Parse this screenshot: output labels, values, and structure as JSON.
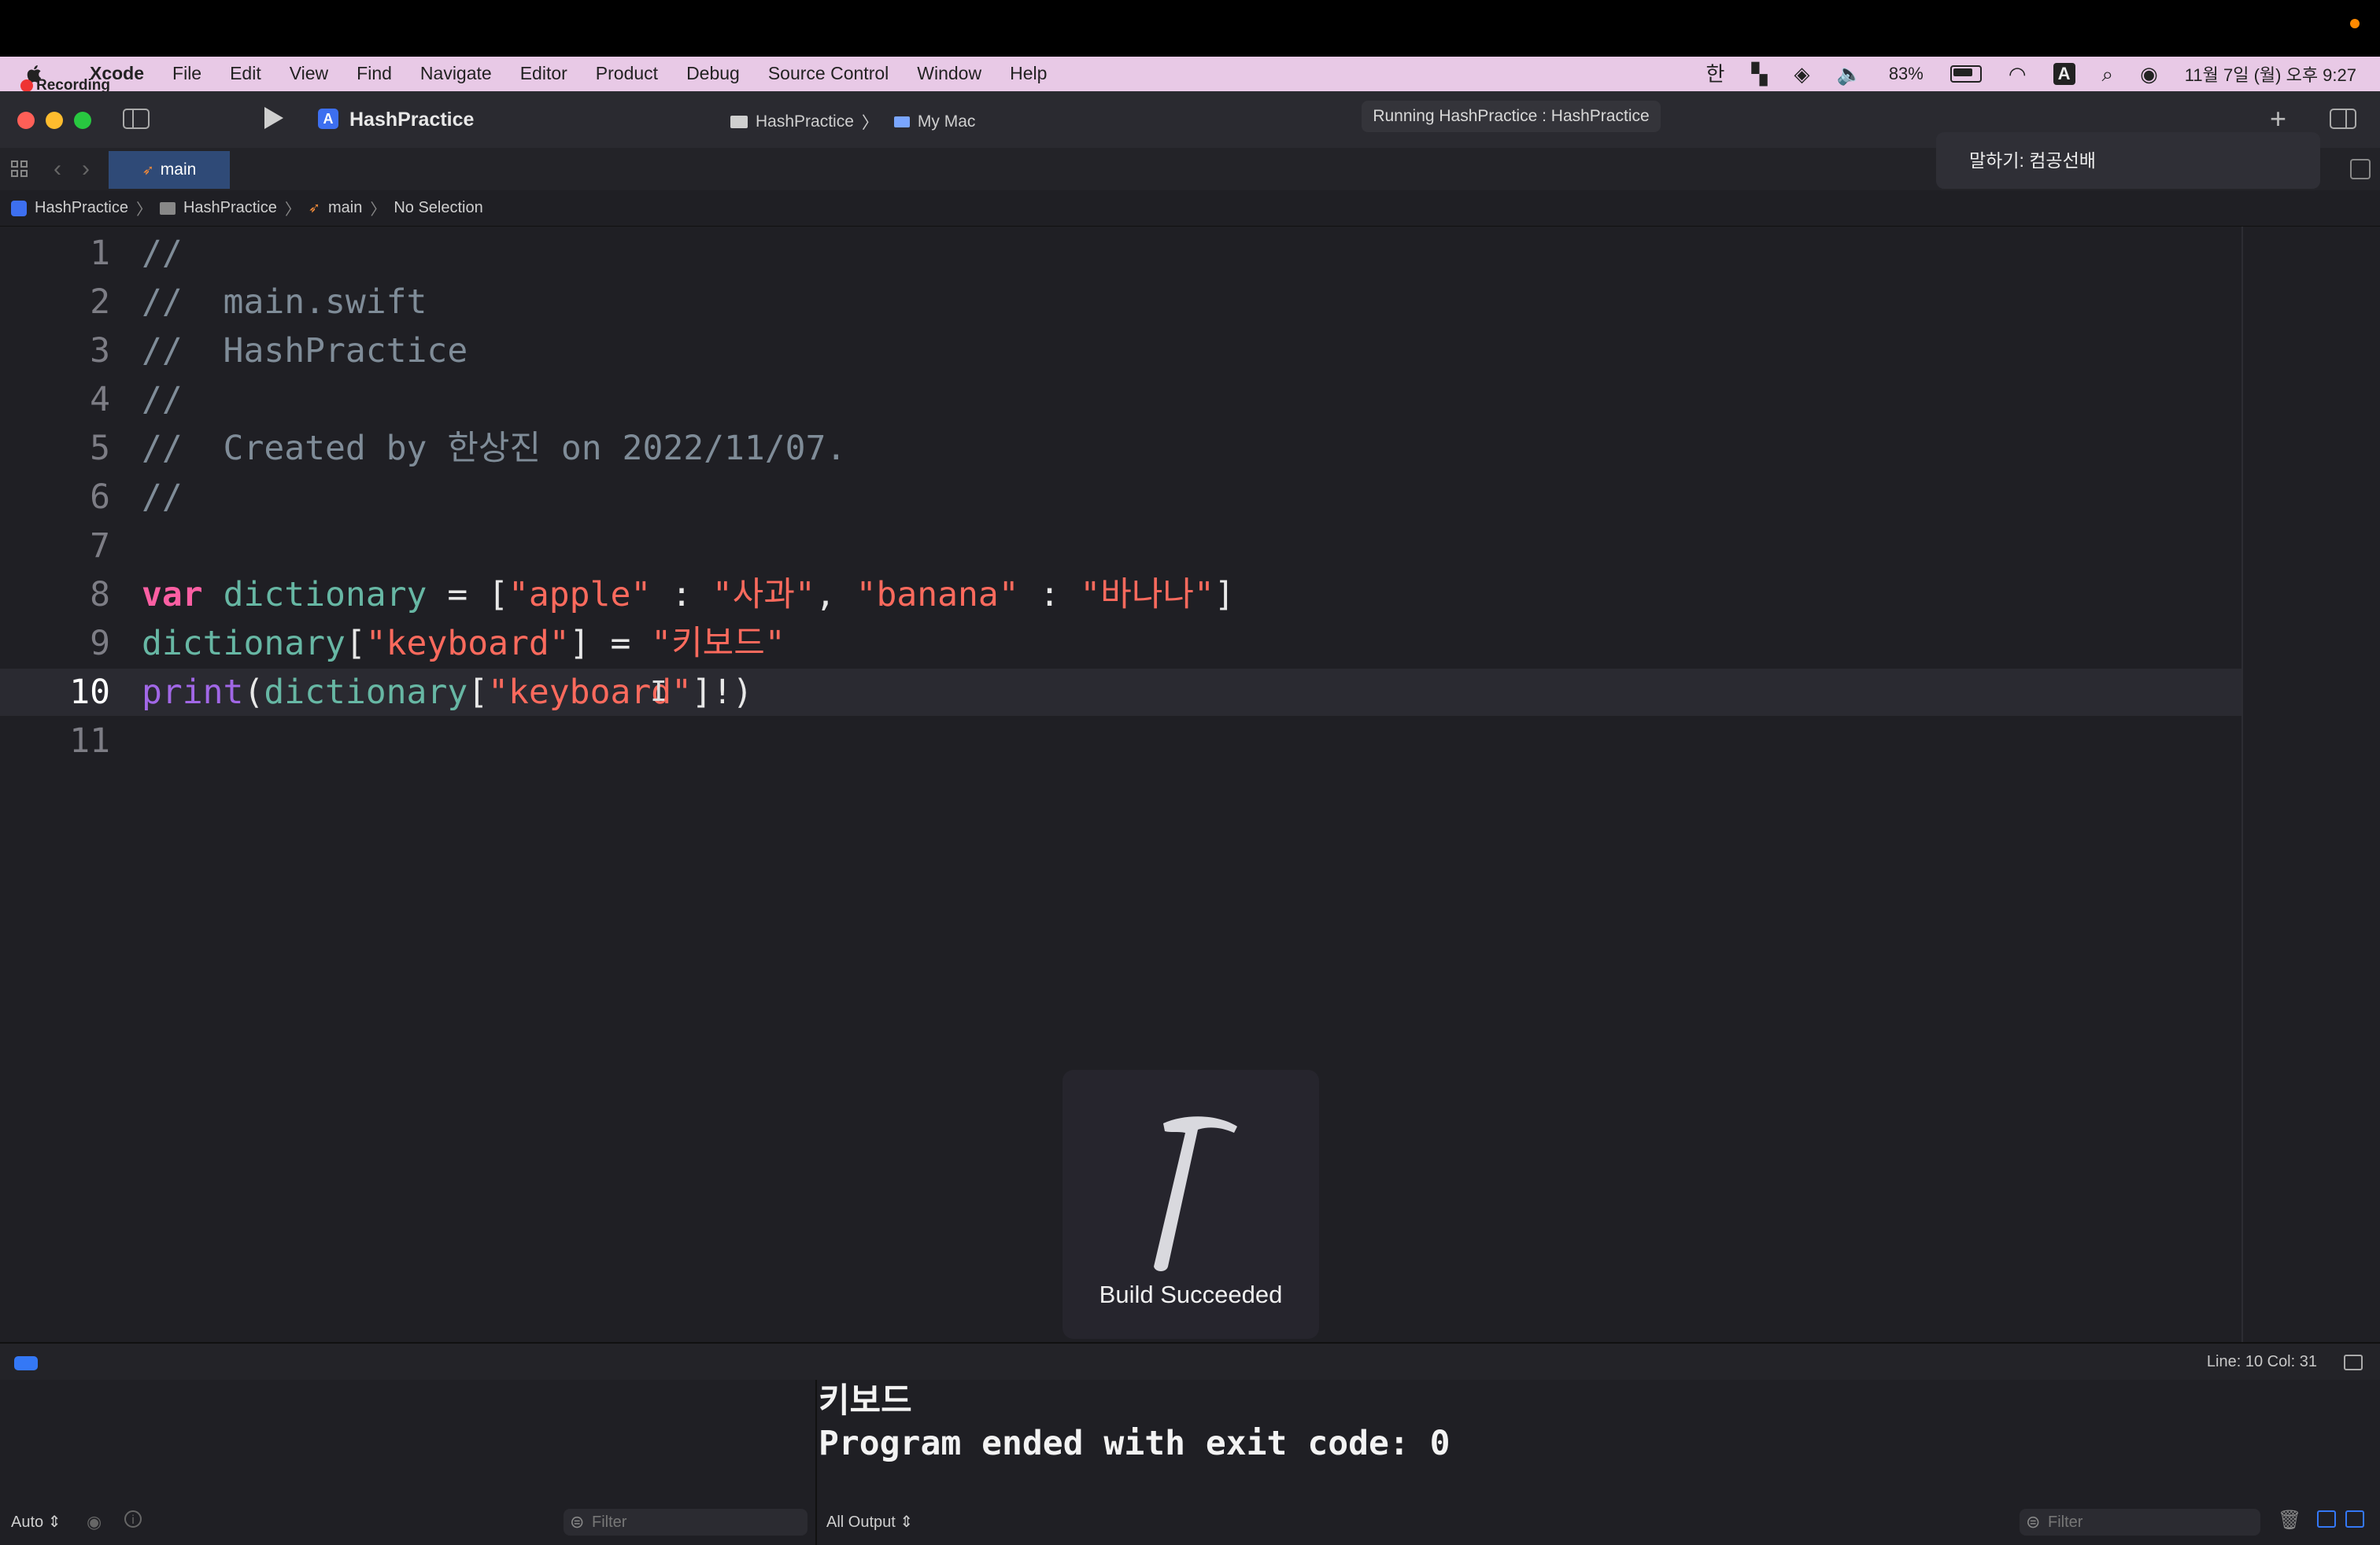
{
  "recording": {
    "label": "Recording"
  },
  "menubar": {
    "app": "Xcode",
    "items": [
      "File",
      "Edit",
      "View",
      "Find",
      "Navigate",
      "Editor",
      "Product",
      "Debug",
      "Source Control",
      "Window",
      "Help"
    ],
    "status": {
      "input_source": "한",
      "battery": "83%",
      "keyboard": "A",
      "datetime": "11월 7일 (월) 오후 9:27"
    }
  },
  "toolbar": {
    "project": "HashPractice",
    "scheme": "HashPractice",
    "destination": "My Mac",
    "activity": "Running HashPractice : HashPractice"
  },
  "tabs": [
    {
      "label": "main"
    }
  ],
  "jumpbar": [
    "HashPractice",
    "HashPractice",
    "main",
    "No Selection"
  ],
  "editor": {
    "lines": [
      {
        "n": "1",
        "tokens": [
          {
            "t": "cm",
            "v": "//"
          }
        ]
      },
      {
        "n": "2",
        "tokens": [
          {
            "t": "cm",
            "v": "//  main.swift"
          }
        ]
      },
      {
        "n": "3",
        "tokens": [
          {
            "t": "cm",
            "v": "//  HashPractice"
          }
        ]
      },
      {
        "n": "4",
        "tokens": [
          {
            "t": "cm",
            "v": "//"
          }
        ]
      },
      {
        "n": "5",
        "tokens": [
          {
            "t": "cm",
            "v": "//  Created by 한상진 on 2022/11/07."
          }
        ]
      },
      {
        "n": "6",
        "tokens": [
          {
            "t": "cm",
            "v": "//"
          }
        ]
      },
      {
        "n": "7",
        "tokens": []
      },
      {
        "n": "8",
        "tokens": [
          {
            "t": "kw",
            "v": "var"
          },
          {
            "t": "pl",
            "v": " "
          },
          {
            "t": "id",
            "v": "dictionary"
          },
          {
            "t": "pl",
            "v": " = ["
          },
          {
            "t": "str",
            "v": "\"apple\""
          },
          {
            "t": "pl",
            "v": " : "
          },
          {
            "t": "str",
            "v": "\"사과\""
          },
          {
            "t": "pl",
            "v": ", "
          },
          {
            "t": "str",
            "v": "\"banana\""
          },
          {
            "t": "pl",
            "v": " : "
          },
          {
            "t": "str",
            "v": "\"바나나\""
          },
          {
            "t": "pl",
            "v": "]"
          }
        ]
      },
      {
        "n": "9",
        "tokens": [
          {
            "t": "id",
            "v": "dictionary"
          },
          {
            "t": "pl",
            "v": "["
          },
          {
            "t": "str",
            "v": "\"keyboard\""
          },
          {
            "t": "pl",
            "v": "] = "
          },
          {
            "t": "str",
            "v": "\"키보드\""
          }
        ]
      },
      {
        "n": "10",
        "current": true,
        "tokens": [
          {
            "t": "fn",
            "v": "print"
          },
          {
            "t": "pl",
            "v": "("
          },
          {
            "t": "id",
            "v": "dictionary"
          },
          {
            "t": "pl",
            "v": "["
          },
          {
            "t": "str",
            "v": "\"keyboard\""
          },
          {
            "t": "pl",
            "v": "]!)"
          }
        ]
      },
      {
        "n": "11",
        "tokens": []
      }
    ]
  },
  "build_hud": {
    "text": "Build Succeeded"
  },
  "notification": {
    "text": "말하기: 컴공선배"
  },
  "debugbar": {
    "cursor_position": "Line: 10  Col: 31"
  },
  "console": {
    "lines": [
      "키보드",
      "Program ended with exit code: 0"
    ],
    "variables_scope": "Auto ⇕",
    "output_scope": "All Output ⇕",
    "filter_placeholder": "Filter"
  }
}
